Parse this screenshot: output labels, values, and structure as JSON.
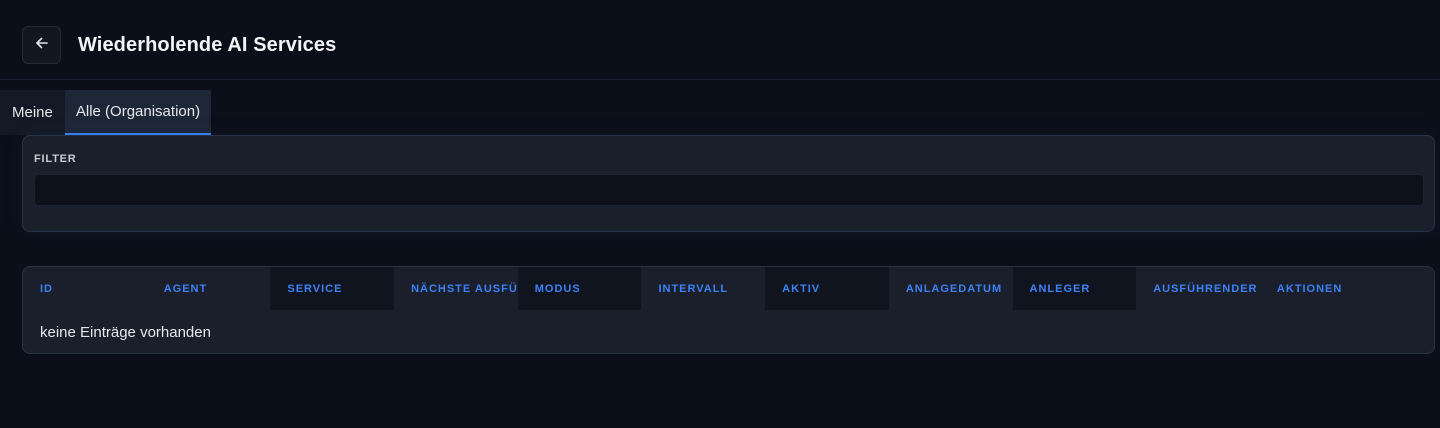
{
  "header": {
    "back_icon": "arrow-left-icon",
    "title": "Wiederholende AI Services"
  },
  "tabs": [
    {
      "label": "Meine",
      "active": false
    },
    {
      "label": "Alle (Organisation)",
      "active": true
    }
  ],
  "filter": {
    "label": "FILTER",
    "value": ""
  },
  "table": {
    "columns": [
      "ID",
      "AGENT",
      "SERVICE",
      "NÄCHSTE AUSFÜH",
      "MODUS",
      "INTERVALL",
      "AKTIV",
      "ANLAGEDATUM",
      "ANLEGER",
      "AUSFÜHRENDER B",
      "AKTIONEN"
    ],
    "empty_text": "keine Einträge vorhanden"
  },
  "colors": {
    "background": "#0b0f1a",
    "card": "#1a202b",
    "accent": "#3b82f6"
  }
}
